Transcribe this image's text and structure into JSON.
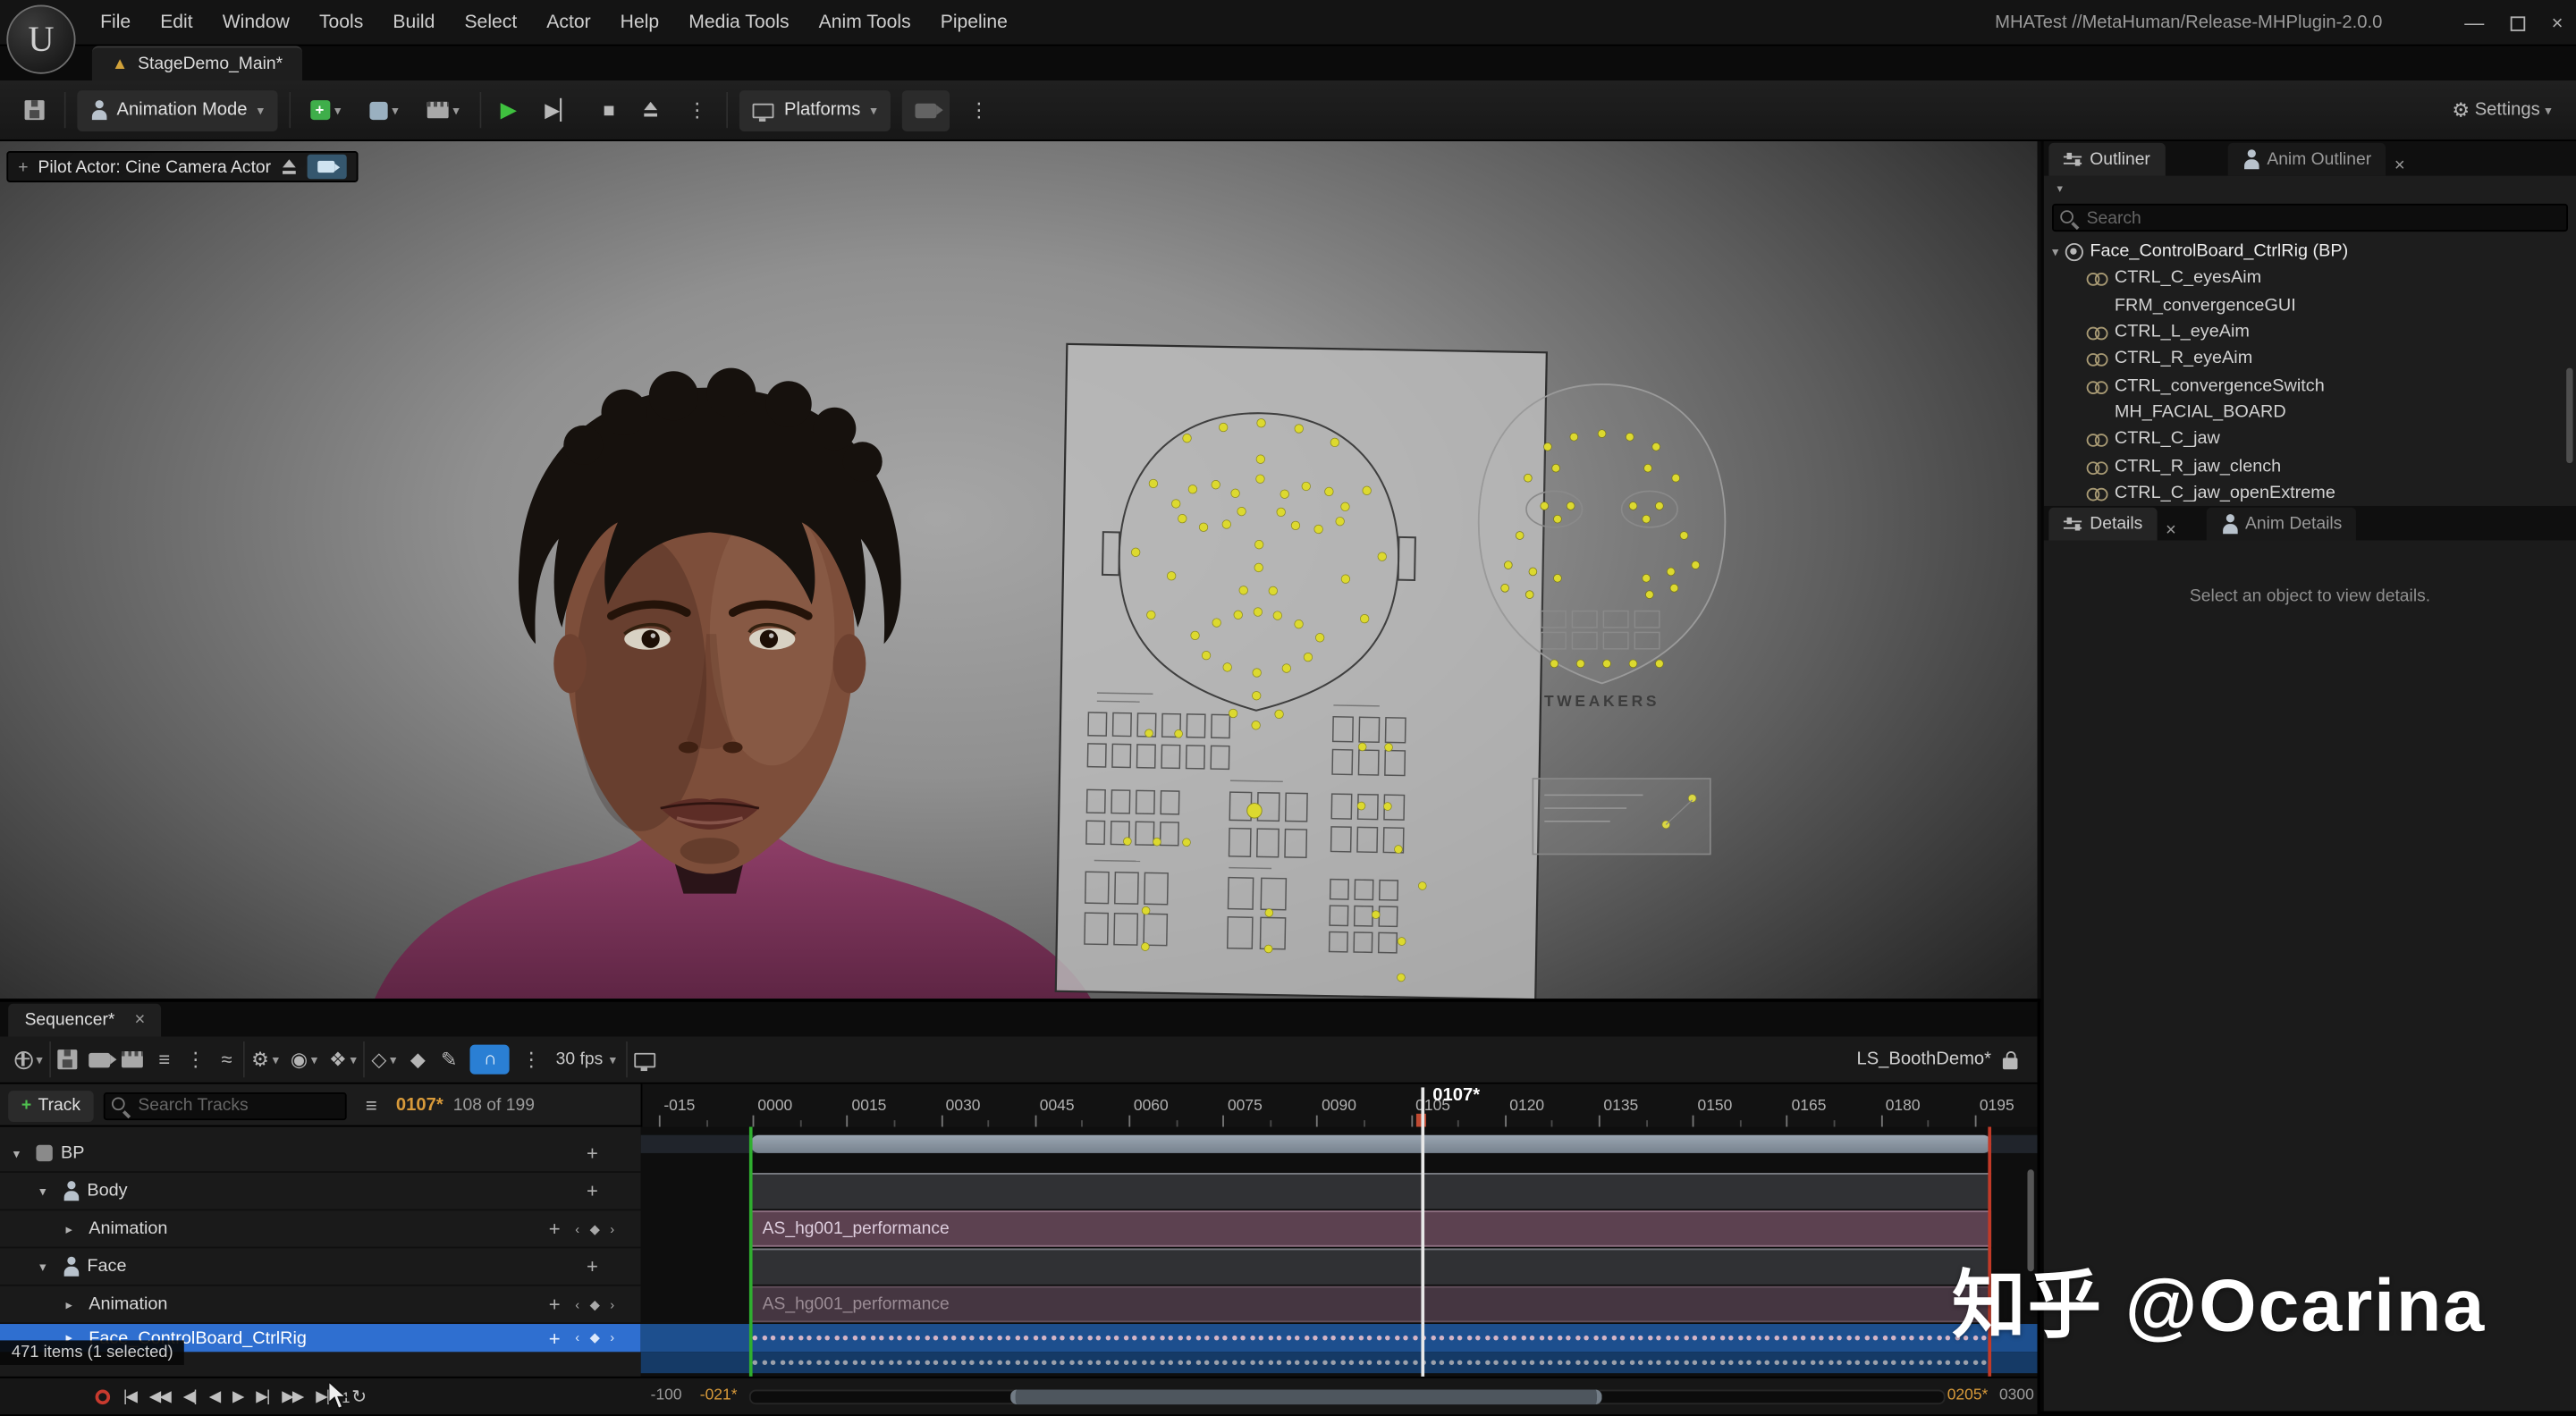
{
  "titlebar": {
    "menus": [
      "File",
      "Edit",
      "Window",
      "Tools",
      "Build",
      "Select",
      "Actor",
      "Help",
      "Media Tools",
      "Anim Tools",
      "Pipeline"
    ],
    "project_title": "MHATest //MetaHuman/Release-MHPlugin-2.0.0"
  },
  "level_tab": "StageDemo_Main*",
  "toolbar": {
    "mode": "Animation Mode",
    "platforms": "Platforms",
    "settings": "Settings"
  },
  "viewport": {
    "pilot": "Pilot Actor: Cine Camera Actor",
    "tweakers_label": "TWEAKERS"
  },
  "outliner": {
    "tab": "Outliner",
    "anim_tab": "Anim Outliner",
    "search": "Search",
    "root": "Face_ControlBoard_CtrlRig (BP)",
    "items": [
      {
        "label": "CTRL_C_eyesAim",
        "icon": "link"
      },
      {
        "label": "FRM_convergenceGUI",
        "icon": "none"
      },
      {
        "label": "CTRL_L_eyeAim",
        "icon": "link"
      },
      {
        "label": "CTRL_R_eyeAim",
        "icon": "link"
      },
      {
        "label": "CTRL_convergenceSwitch",
        "icon": "link"
      },
      {
        "label": "MH_FACIAL_BOARD",
        "icon": "none"
      },
      {
        "label": "CTRL_C_jaw",
        "icon": "link"
      },
      {
        "label": "CTRL_R_jaw_clench",
        "icon": "link"
      },
      {
        "label": "CTRL_C_jaw_openExtreme",
        "icon": "link"
      }
    ]
  },
  "details": {
    "tab": "Details",
    "anim_tab": "Anim Details",
    "empty": "Select an object to view details."
  },
  "sequencer": {
    "tab": "Sequencer*",
    "fps": "30 fps",
    "name": "LS_BoothDemo*",
    "add_track": "Track",
    "search": "Search Tracks",
    "frame": "0107*",
    "count": "108 of 199",
    "playhead": "0107*",
    "status": "471 items (1 selected)",
    "ticks": [
      "-015",
      "0000",
      "0015",
      "0030",
      "0045",
      "0060",
      "0075",
      "0090",
      "0105",
      "0120",
      "0135",
      "0150",
      "0165",
      "0180",
      "0195"
    ],
    "range": {
      "left": "-100",
      "in": "-021*",
      "out": "0205*",
      "right": "0300"
    },
    "transport": [
      "|◀",
      "◀◀",
      "◀|",
      "◀",
      "▶",
      "▶|",
      "▶▶",
      "▶|"
    ],
    "loop_count": "1",
    "tracks": [
      {
        "label": "BP",
        "indent": 0,
        "kind": "bp",
        "expanded": true
      },
      {
        "label": "Body",
        "indent": 1,
        "kind": "actor",
        "expanded": true
      },
      {
        "label": "Animation",
        "indent": 2,
        "kind": "anim",
        "expanded": false,
        "clip": "AS_hg001_performance"
      },
      {
        "label": "Face",
        "indent": 1,
        "kind": "actor",
        "expanded": true
      },
      {
        "label": "Animation",
        "indent": 2,
        "kind": "anim",
        "expanded": false,
        "clip": "AS_hg001_performance"
      },
      {
        "label": "Face_ControlBoard_CtrlRig",
        "indent": 2,
        "kind": "rig",
        "expanded": false,
        "selected": true
      }
    ]
  },
  "icons": {
    "caret_down": "▾",
    "caret_right": "▸",
    "close": "×",
    "minimize": "—",
    "play": "▶",
    "stop": "■",
    "dots": "⋮",
    "gear": "⚙",
    "diamond": "◆",
    "diamond_o": "◇",
    "snap": "∩",
    "list": "≡",
    "curve": "≈",
    "eye": "◉",
    "flask": "❖",
    "pencil": "✎",
    "loop": "↻",
    "filter": "≡",
    "keynav": "‹ ◆ ›",
    "plus": "+"
  },
  "colors": {
    "accent_blue": "#2f6fd0",
    "frame_orange": "#d89a3a",
    "play_green": "#3fc13f",
    "record_red": "#c83a2e",
    "clip_mauve": "#5c4150",
    "board_dot_yellow": "#dcd92f"
  },
  "watermark": "知乎 @Ocarina"
}
